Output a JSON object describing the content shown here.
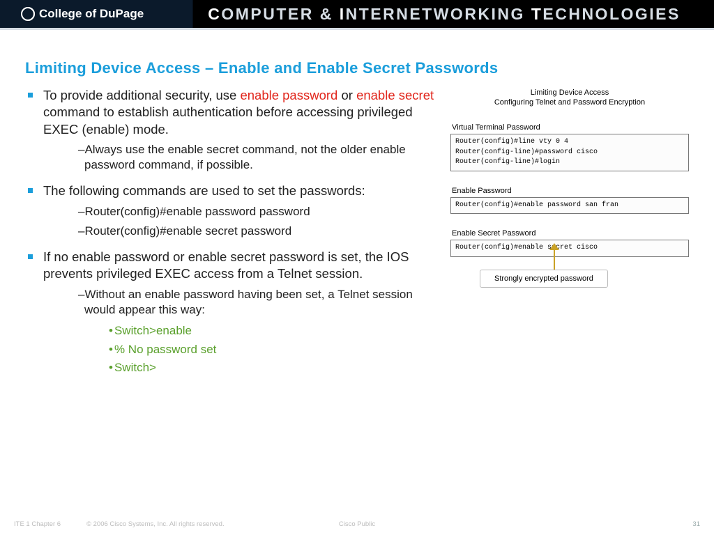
{
  "header": {
    "college": "College of DuPage",
    "cit": {
      "computer": "COMPUTER",
      "amp": "&",
      "internetworking": "INTERNETWORKING",
      "tech": "TECHNOLOGIES"
    }
  },
  "title": "Limiting Device Access – Enable and Enable Secret Passwords",
  "b1": {
    "pre": "To provide additional security, use ",
    "ep": "enable password",
    "mid": " or ",
    "es": "enable secret",
    "post": " command to establish authentication before accessing privileged EXEC (enable) mode."
  },
  "b1sub": "Always use the enable secret command, not the older enable password command, if possible.",
  "b2": "The following commands are used to set the passwords:",
  "b2sub1": "Router(config)#enable password password",
  "b2sub2": "Router(config)#enable secret password",
  "b3": "If no enable password or enable secret password is set, the IOS prevents privileged EXEC access from a Telnet session.",
  "b3sub": "Without an enable password having been set, a Telnet session would appear this way:",
  "term_lines": {
    "l1": "Switch>enable",
    "l2": "% No password set",
    "l3": "Switch>"
  },
  "right": {
    "title": "Limiting Device Access",
    "subtitle": "Configuring Telnet and Password Encryption",
    "vtp_label": "Virtual Terminal Password",
    "vtp_box": "Router(config)#line vty 0 4\nRouter(config-line)#password cisco\nRouter(config-line)#login",
    "ep_label": "Enable Password",
    "ep_box": "Router(config)#enable password san fran",
    "esp_label": "Enable Secret Password",
    "esp_box": "Router(config)#enable secret cisco",
    "callout": "Strongly encrypted password"
  },
  "footer": {
    "left": "ITE 1 Chapter 6",
    "mid": "© 2006 Cisco Systems, Inc. All rights reserved.",
    "pub": "Cisco Public",
    "page": "31"
  }
}
